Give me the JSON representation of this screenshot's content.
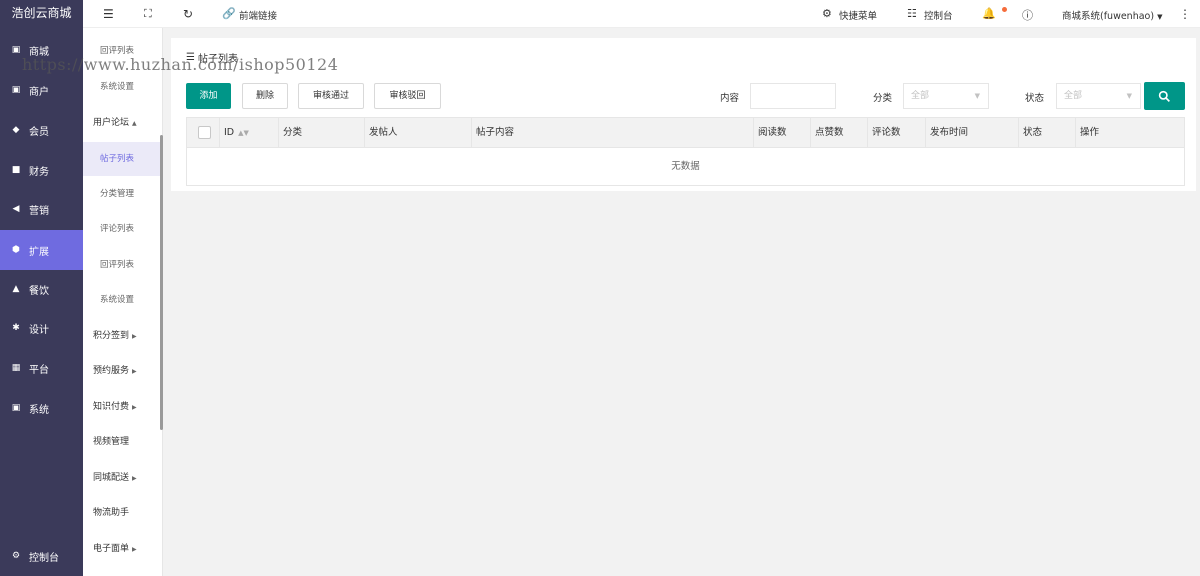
{
  "brand": "浩创云商城",
  "main_menu": [
    {
      "label": "商城",
      "icon": "shop-icon",
      "glyph": "▣"
    },
    {
      "label": "商户",
      "icon": "merchant-icon",
      "glyph": "▣"
    },
    {
      "label": "会员",
      "icon": "member-icon",
      "glyph": "◆"
    },
    {
      "label": "财务",
      "icon": "finance-icon",
      "glyph": "■"
    },
    {
      "label": "营销",
      "icon": "megaphone-icon",
      "glyph": "◀"
    },
    {
      "label": "扩展",
      "icon": "cube-icon",
      "glyph": "⬢"
    },
    {
      "label": "餐饮",
      "icon": "dining-icon",
      "glyph": "▲"
    },
    {
      "label": "设计",
      "icon": "puzzle-icon",
      "glyph": "✱"
    },
    {
      "label": "平台",
      "icon": "grid-icon",
      "glyph": "▦"
    },
    {
      "label": "系统",
      "icon": "system-icon",
      "glyph": "▣"
    }
  ],
  "bottom_menu": {
    "label": "控制台",
    "icon": "gear-icon",
    "glyph": "⚙"
  },
  "sub_menu": {
    "top_items": [
      "回评列表",
      "系统设置"
    ],
    "forum_group": "用户论坛",
    "forum_children": [
      "帖子列表",
      "分类管理",
      "评论列表",
      "回评列表",
      "系统设置"
    ],
    "groups": [
      {
        "label": "积分签到",
        "has_caret": true
      },
      {
        "label": "预约服务",
        "has_caret": true
      },
      {
        "label": "知识付费",
        "has_caret": true
      },
      {
        "label": "视频管理",
        "has_caret": false
      },
      {
        "label": "同城配送",
        "has_caret": true
      },
      {
        "label": "物流助手",
        "has_caret": false
      },
      {
        "label": "电子面单",
        "has_caret": true
      }
    ]
  },
  "topbar": {
    "frontend_link": "前端链接",
    "quick_menu": "快捷菜单",
    "console": "控制台",
    "user": "商城系统(fuwenhao)"
  },
  "watermark": "https://www.huzhan.com/ishop50124",
  "page": {
    "title": "帖子列表",
    "buttons": {
      "add": "添加",
      "delete": "删除",
      "approve": "审核通过",
      "reject": "审核驳回"
    },
    "filters": {
      "content_label": "内容",
      "content_value": "",
      "category_label": "分类",
      "category_value": "全部",
      "status_label": "状态",
      "status_value": "全部"
    },
    "columns": [
      "ID",
      "分类",
      "发帖人",
      "帖子内容",
      "阅读数",
      "点赞数",
      "评论数",
      "发布时间",
      "状态",
      "操作"
    ],
    "empty_text": "无数据"
  },
  "colors": {
    "sidebar": "#3b3a5a",
    "active": "#6f6be0",
    "primary": "#009688",
    "notify_dot": "#f56c3b"
  }
}
